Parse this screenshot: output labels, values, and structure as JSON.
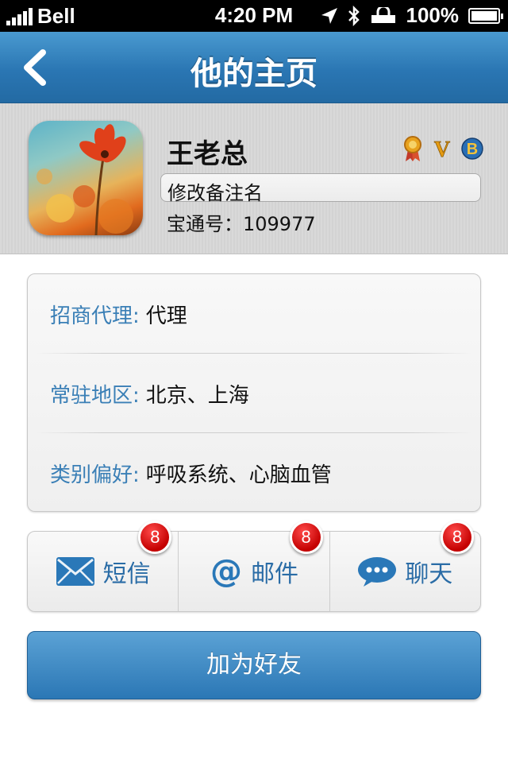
{
  "status_bar": {
    "carrier": "Bell",
    "time": "4:20 PM",
    "battery": "100%"
  },
  "nav": {
    "title": "他的主页",
    "back_icon": "chevron-left-icon"
  },
  "profile": {
    "name": "王老总",
    "remark_placeholder": "修改备注名",
    "account_label": "宝通号：",
    "account_number": "109977",
    "badges": [
      "medal-icon",
      "v-icon",
      "b-icon"
    ]
  },
  "info": [
    {
      "label": "招商代理:",
      "value": "代理"
    },
    {
      "label": "常驻地区:",
      "value": "北京、上海"
    },
    {
      "label": "类别偏好:",
      "value": "呼吸系统、心脑血管"
    }
  ],
  "actions": [
    {
      "label": "短信",
      "icon": "mail-icon",
      "badge": "8"
    },
    {
      "label": "邮件",
      "icon": "at-icon",
      "badge": "8"
    },
    {
      "label": "聊天",
      "icon": "chat-icon",
      "badge": "8"
    }
  ],
  "add_friend_label": "加为好友"
}
